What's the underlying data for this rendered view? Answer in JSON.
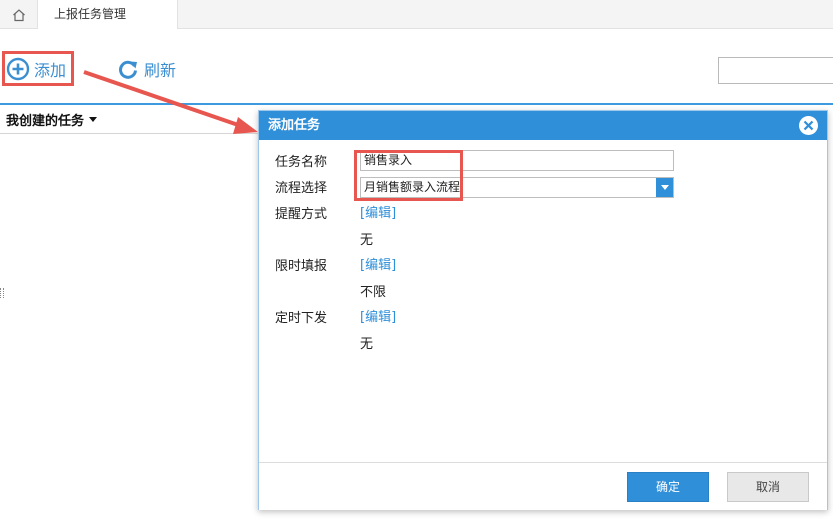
{
  "tabs": [
    {
      "label": "上报任务管理",
      "active": true
    }
  ],
  "toolbar": {
    "add_label": "添加",
    "refresh_label": "刷新",
    "search_placeholder": ""
  },
  "list": {
    "filter_label": "我创建的任务"
  },
  "dialog": {
    "title": "添加任务",
    "fields": {
      "task_name_label": "任务名称",
      "task_name_value": "销售录入",
      "process_label": "流程选择",
      "process_value": "月销售额录入流程",
      "reminder_label": "提醒方式",
      "reminder_edit": "[编辑]",
      "reminder_value": "无",
      "deadline_label": "限时填报",
      "deadline_edit": "[编辑]",
      "deadline_value": "不限",
      "schedule_label": "定时下发",
      "schedule_edit": "[编辑]",
      "schedule_value": "无"
    },
    "ok_label": "确定",
    "cancel_label": "取消"
  },
  "colors": {
    "accent": "#2f8fd8",
    "highlight": "#e8574f"
  },
  "icons": [
    "home-icon",
    "add-circle-icon",
    "refresh-icon",
    "close-icon",
    "dropdown-arrow-icon"
  ]
}
